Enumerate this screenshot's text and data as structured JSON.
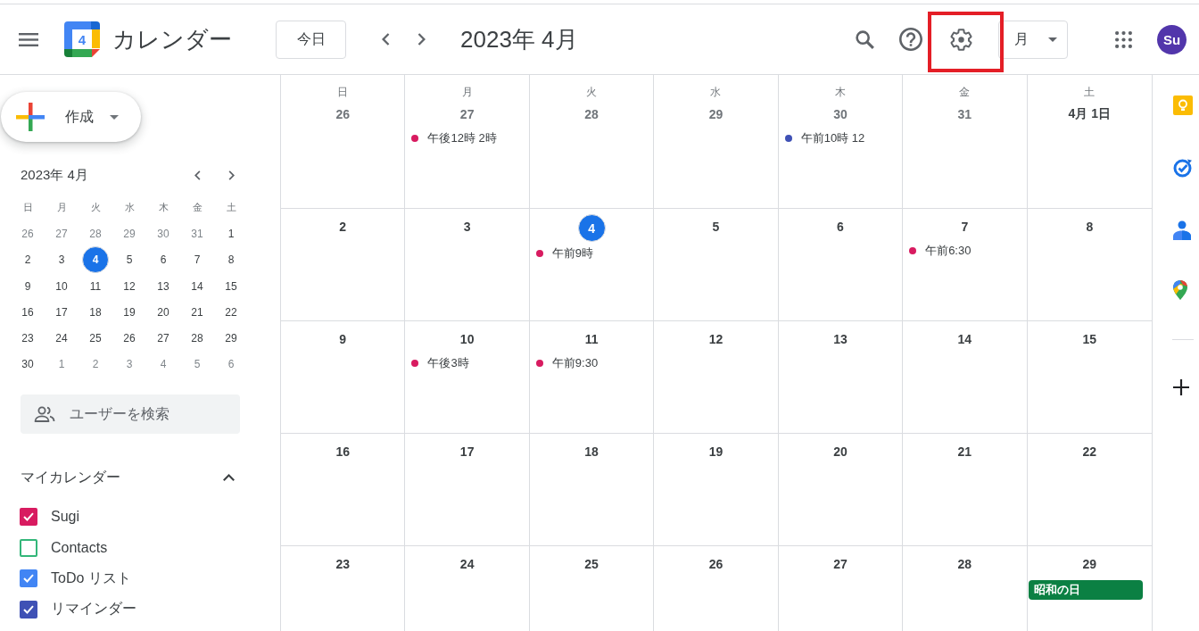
{
  "header": {
    "title": "カレンダー",
    "logo_day": "4",
    "today_button": "今日",
    "period": "2023年 4月",
    "settings_button": {
      "highlighted": true
    },
    "view_selector": "月",
    "avatar": "Su"
  },
  "sidebar": {
    "create_button": "作成",
    "mini_calendar": {
      "title": "2023年 4月",
      "weekdays": [
        "日",
        "月",
        "火",
        "水",
        "木",
        "金",
        "土"
      ],
      "weeks": [
        [
          {
            "label": "26",
            "muted": true,
            "today": false
          },
          {
            "label": "27",
            "muted": true,
            "today": false
          },
          {
            "label": "28",
            "muted": true,
            "today": false
          },
          {
            "label": "29",
            "muted": true,
            "today": false
          },
          {
            "label": "30",
            "muted": true,
            "today": false
          },
          {
            "label": "31",
            "muted": true,
            "today": false
          },
          {
            "label": "1",
            "muted": false,
            "today": false
          }
        ],
        [
          {
            "label": "2",
            "muted": false,
            "today": false
          },
          {
            "label": "3",
            "muted": false,
            "today": false
          },
          {
            "label": "4",
            "muted": false,
            "today": true
          },
          {
            "label": "5",
            "muted": false,
            "today": false
          },
          {
            "label": "6",
            "muted": false,
            "today": false
          },
          {
            "label": "7",
            "muted": false,
            "today": false
          },
          {
            "label": "8",
            "muted": false,
            "today": false
          }
        ],
        [
          {
            "label": "9",
            "muted": false,
            "today": false
          },
          {
            "label": "10",
            "muted": false,
            "today": false
          },
          {
            "label": "11",
            "muted": false,
            "today": false
          },
          {
            "label": "12",
            "muted": false,
            "today": false
          },
          {
            "label": "13",
            "muted": false,
            "today": false
          },
          {
            "label": "14",
            "muted": false,
            "today": false
          },
          {
            "label": "15",
            "muted": false,
            "today": false
          }
        ],
        [
          {
            "label": "16",
            "muted": false,
            "today": false
          },
          {
            "label": "17",
            "muted": false,
            "today": false
          },
          {
            "label": "18",
            "muted": false,
            "today": false
          },
          {
            "label": "19",
            "muted": false,
            "today": false
          },
          {
            "label": "20",
            "muted": false,
            "today": false
          },
          {
            "label": "21",
            "muted": false,
            "today": false
          },
          {
            "label": "22",
            "muted": false,
            "today": false
          }
        ],
        [
          {
            "label": "23",
            "muted": false,
            "today": false
          },
          {
            "label": "24",
            "muted": false,
            "today": false
          },
          {
            "label": "25",
            "muted": false,
            "today": false
          },
          {
            "label": "26",
            "muted": false,
            "today": false
          },
          {
            "label": "27",
            "muted": false,
            "today": false
          },
          {
            "label": "28",
            "muted": false,
            "today": false
          },
          {
            "label": "29",
            "muted": false,
            "today": false
          }
        ],
        [
          {
            "label": "30",
            "muted": false,
            "today": false
          },
          {
            "label": "1",
            "muted": true,
            "today": false
          },
          {
            "label": "2",
            "muted": true,
            "today": false
          },
          {
            "label": "3",
            "muted": true,
            "today": false
          },
          {
            "label": "4",
            "muted": true,
            "today": false
          },
          {
            "label": "5",
            "muted": true,
            "today": false
          },
          {
            "label": "6",
            "muted": true,
            "today": false
          }
        ]
      ]
    },
    "people_search": {
      "placeholder": "ユーザーを検索"
    },
    "my_calendars": {
      "title": "マイカレンダー",
      "expanded": true,
      "items": [
        {
          "name": "Sugi",
          "checked": true,
          "color": "#d81b60"
        },
        {
          "name": "Contacts",
          "checked": false,
          "color": "#33b679"
        },
        {
          "name": "ToDo リスト",
          "checked": true,
          "color": "#4285f4"
        },
        {
          "name": "リマインダー",
          "checked": true,
          "color": "#3f51b5"
        }
      ]
    }
  },
  "month_grid": {
    "weekdays": [
      "日",
      "月",
      "火",
      "水",
      "木",
      "金",
      "土"
    ],
    "weeks": [
      [
        {
          "date": "26",
          "muted": true,
          "today": false
        },
        {
          "date": "27",
          "muted": true,
          "today": false,
          "events": [
            {
              "kind": "timed",
              "text": "午後12時 2時",
              "color": "#d81b60"
            }
          ]
        },
        {
          "date": "28",
          "muted": true,
          "today": false
        },
        {
          "date": "29",
          "muted": true,
          "today": false
        },
        {
          "date": "30",
          "muted": true,
          "today": false,
          "events": [
            {
              "kind": "timed",
              "text": "午前10時 12",
              "color": "#3f51b5"
            }
          ]
        },
        {
          "date": "31",
          "muted": true,
          "today": false
        },
        {
          "date": "4月 1日",
          "muted": false,
          "today": false
        }
      ],
      [
        {
          "date": "2",
          "muted": false,
          "today": false
        },
        {
          "date": "3",
          "muted": false,
          "today": false
        },
        {
          "date": "4",
          "muted": false,
          "today": true,
          "events": [
            {
              "kind": "timed",
              "text": "午前9時",
              "color": "#d81b60"
            }
          ]
        },
        {
          "date": "5",
          "muted": false,
          "today": false
        },
        {
          "date": "6",
          "muted": false,
          "today": false
        },
        {
          "date": "7",
          "muted": false,
          "today": false,
          "events": [
            {
              "kind": "timed",
              "text": "午前6:30",
              "color": "#d81b60"
            }
          ]
        },
        {
          "date": "8",
          "muted": false,
          "today": false
        }
      ],
      [
        {
          "date": "9",
          "muted": false,
          "today": false
        },
        {
          "date": "10",
          "muted": false,
          "today": false,
          "events": [
            {
              "kind": "timed",
              "text": "午後3時",
              "color": "#d81b60"
            }
          ]
        },
        {
          "date": "11",
          "muted": false,
          "today": false,
          "events": [
            {
              "kind": "timed",
              "text": "午前9:30",
              "color": "#d81b60"
            }
          ]
        },
        {
          "date": "12",
          "muted": false,
          "today": false
        },
        {
          "date": "13",
          "muted": false,
          "today": false
        },
        {
          "date": "14",
          "muted": false,
          "today": false
        },
        {
          "date": "15",
          "muted": false,
          "today": false
        }
      ],
      [
        {
          "date": "16",
          "muted": false,
          "today": false
        },
        {
          "date": "17",
          "muted": false,
          "today": false
        },
        {
          "date": "18",
          "muted": false,
          "today": false
        },
        {
          "date": "19",
          "muted": false,
          "today": false
        },
        {
          "date": "20",
          "muted": false,
          "today": false
        },
        {
          "date": "21",
          "muted": false,
          "today": false
        },
        {
          "date": "22",
          "muted": false,
          "today": false
        }
      ],
      [
        {
          "date": "23",
          "muted": false,
          "today": false
        },
        {
          "date": "24",
          "muted": false,
          "today": false
        },
        {
          "date": "25",
          "muted": false,
          "today": false
        },
        {
          "date": "26",
          "muted": false,
          "today": false
        },
        {
          "date": "27",
          "muted": false,
          "today": false
        },
        {
          "date": "28",
          "muted": false,
          "today": false
        },
        {
          "date": "29",
          "muted": false,
          "today": false,
          "events": [
            {
              "kind": "all_day",
              "text": "昭和の日",
              "color": "#0b8043"
            }
          ]
        }
      ]
    ]
  }
}
